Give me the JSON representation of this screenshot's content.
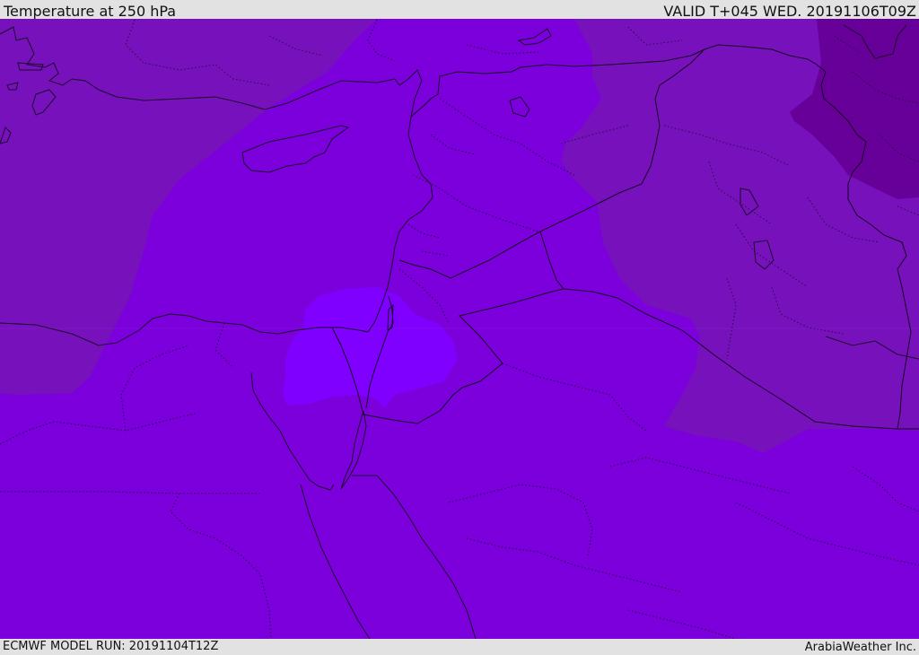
{
  "header": {
    "title": "Temperature at 250 hPa",
    "valid": "VALID T+045 WED. 20191106T09Z"
  },
  "footer": {
    "model_run": "ECMWF MODEL RUN: 20191104T12Z",
    "credit": "ArabiaWeather Inc."
  },
  "colors": {
    "background_field": "#7b00dc",
    "cooler_field": "#7711bb",
    "coldest_field": "#660099",
    "warm_pocket": "#7f00ff"
  }
}
